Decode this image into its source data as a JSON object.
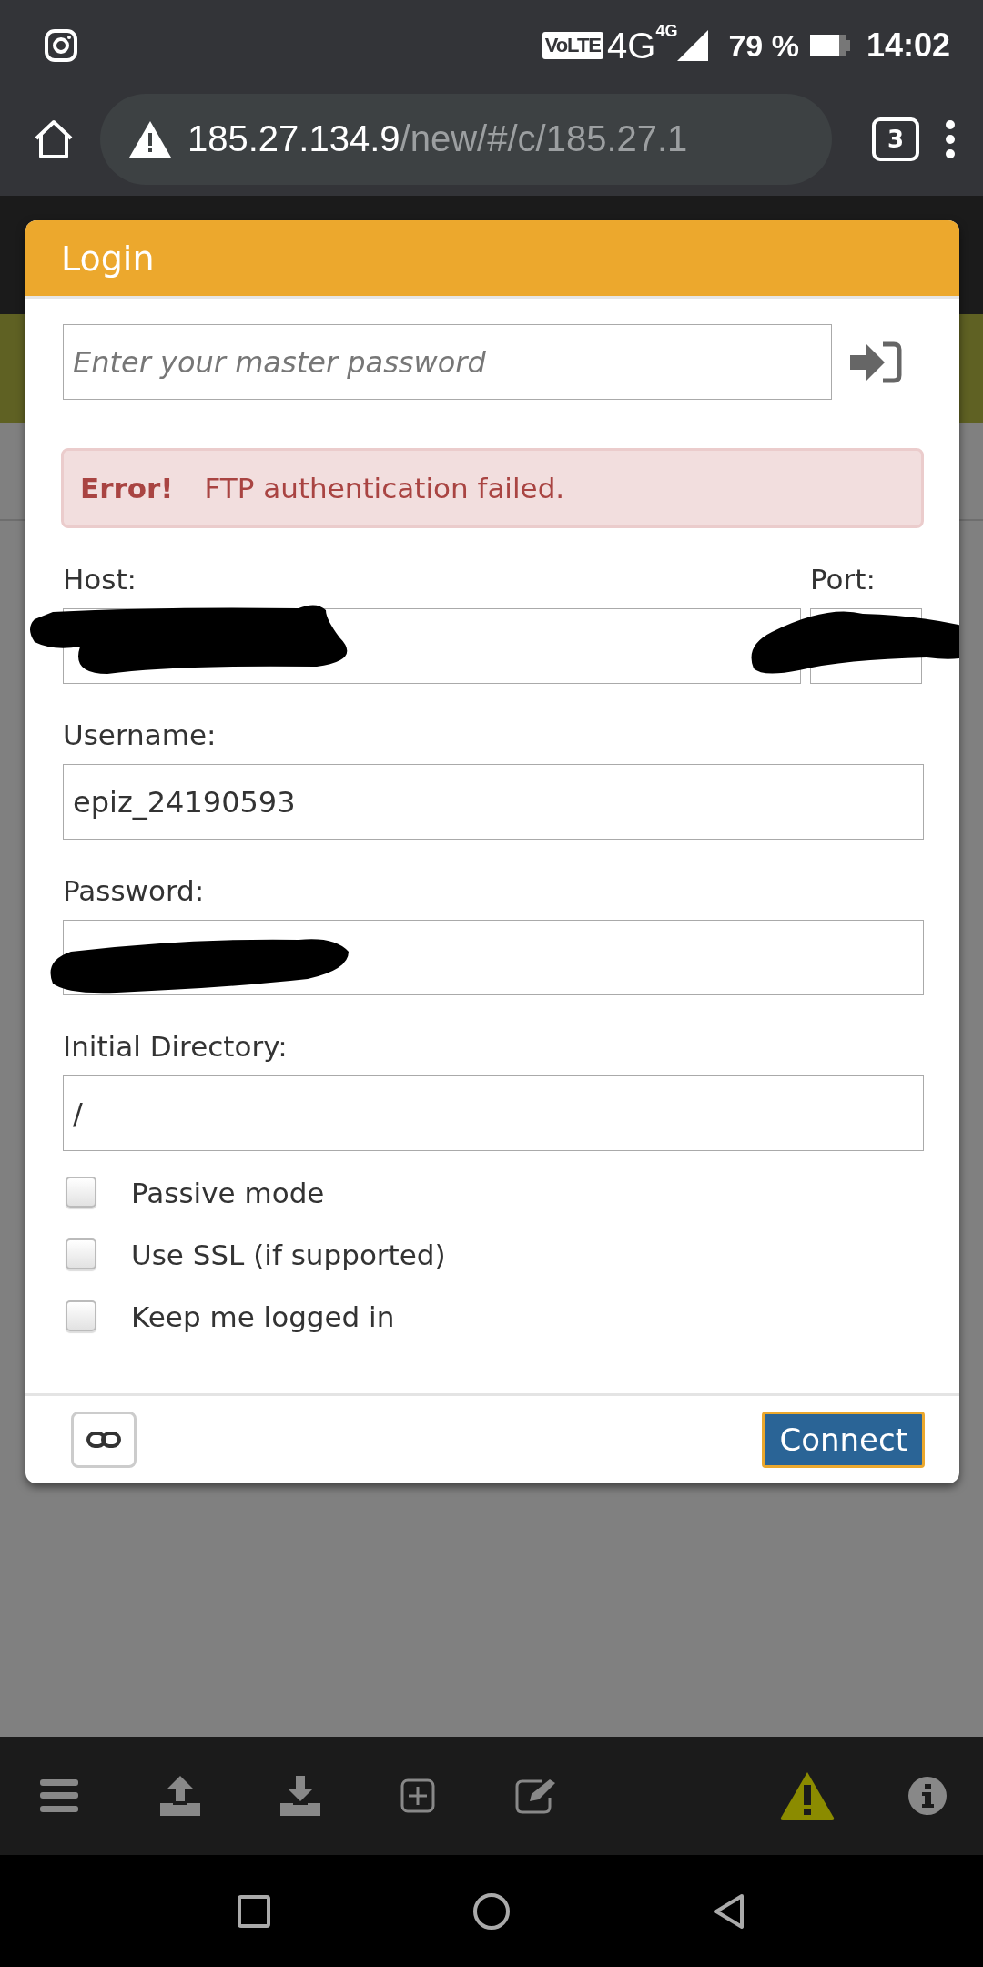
{
  "status_bar": {
    "network": "VoLTE",
    "signal": "4G",
    "signal_sup": "4G",
    "battery": "79 %",
    "time": "14:02"
  },
  "browser": {
    "url_host": "185.27.134.9",
    "url_path": "/new/#/c/185.27.1",
    "tab_count": "3"
  },
  "dialog": {
    "title": "Login",
    "master_password": {
      "placeholder": "Enter your master password"
    },
    "error": {
      "label": "Error!",
      "message": "FTP authentication failed."
    },
    "host": {
      "label": "Host:"
    },
    "port": {
      "label": "Port:"
    },
    "username": {
      "label": "Username:",
      "value": "epiz_24190593"
    },
    "password": {
      "label": "Password:"
    },
    "initial_directory": {
      "label": "Initial Directory:",
      "value": "/"
    },
    "options": [
      {
        "label": "Passive mode",
        "checked": false
      },
      {
        "label": "Use SSL (if supported)",
        "checked": false
      },
      {
        "label": "Keep me logged in",
        "checked": false
      }
    ],
    "connect_button": "Connect"
  }
}
